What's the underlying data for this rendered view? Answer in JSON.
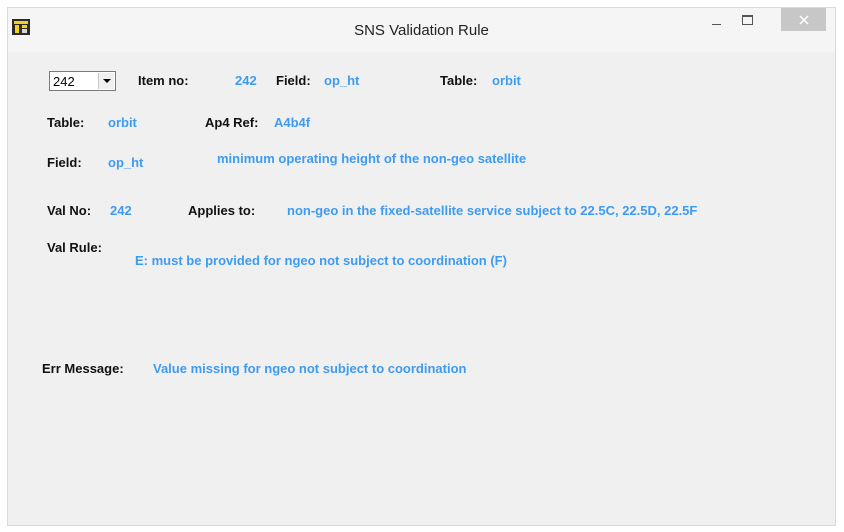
{
  "window": {
    "title": "SNS Validation Rule"
  },
  "combo": {
    "selected": "242"
  },
  "header": {
    "item_no_label": "Item no:",
    "item_no_value": "242",
    "field_label": "Field:",
    "field_value": "op_ht",
    "table_label": "Table:",
    "table_value": "orbit"
  },
  "row2": {
    "table_label": "Table:",
    "table_value": "orbit",
    "ap4_label": "Ap4 Ref:",
    "ap4_value": "A4b4f"
  },
  "row3": {
    "field_label": "Field:",
    "field_value": "op_ht",
    "description": "minimum operating height of the non-geo satellite"
  },
  "row4": {
    "valno_label": "Val No:",
    "valno_value": "242",
    "applies_label": "Applies to:",
    "applies_value": "non-geo in the fixed-satellite service subject to 22.5C, 22.5D, 22.5F"
  },
  "rule": {
    "label": "Val Rule:",
    "value": "E: must be provided for ngeo not subject to coordination (F)"
  },
  "error": {
    "label": "Err Message:",
    "value": "Value missing for ngeo not subject to coordination"
  },
  "colors": {
    "value_text": "#3f9bf0",
    "label_text": "#111111",
    "background": "#f0f0f0"
  }
}
